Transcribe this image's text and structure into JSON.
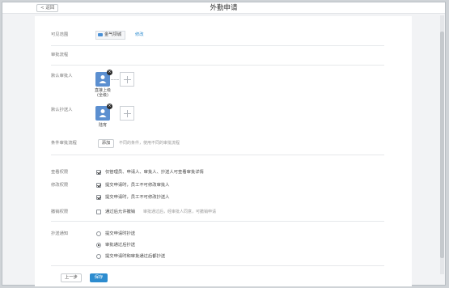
{
  "header": {
    "back_label": "< 返回",
    "title": "外勤申请"
  },
  "visible_range": {
    "label": "可见范围",
    "value": "金气坝城",
    "edit_link": "修改"
  },
  "approval_flow": {
    "section_label": "审批流程"
  },
  "default_approver": {
    "label": "默认审批人",
    "name": "直接上级",
    "sub": "(全级)"
  },
  "default_cc": {
    "label": "默认抄送人",
    "name": "陆宵"
  },
  "conditional_flow": {
    "label": "条件审批流程",
    "add_button": "添加",
    "hint": "不同的条件，使用不同的审批流程"
  },
  "view_permission": {
    "label": "查看权限",
    "options": [
      {
        "text": "仅管理员、申请人、审批人、抄送人可查看审批详情",
        "checked": true
      }
    ]
  },
  "modify_permission": {
    "label": "修改权限",
    "options": [
      {
        "text": "提交申请时，员工不可修改审批人",
        "checked": true
      },
      {
        "text": "提交申请时，员工不可修改抄送人",
        "checked": true
      }
    ]
  },
  "revoke_permission": {
    "label": "撤销权限",
    "options": [
      {
        "text": "通过后允许撤销",
        "checked": false
      }
    ],
    "hint": "审批通过后，经审批人同意，可撤销申请"
  },
  "cc_notify": {
    "label": "抄送通知",
    "options": [
      {
        "text": "提交申请时抄送",
        "selected": false
      },
      {
        "text": "审批通过后抄送",
        "selected": true
      },
      {
        "text": "提交申请时和审批通过后都抄送",
        "selected": false
      }
    ]
  },
  "footer": {
    "prev_label": "上一步",
    "save_label": "保存"
  },
  "colors": {
    "accent": "#2d8ccf",
    "avatar": "#5b8fd0"
  }
}
